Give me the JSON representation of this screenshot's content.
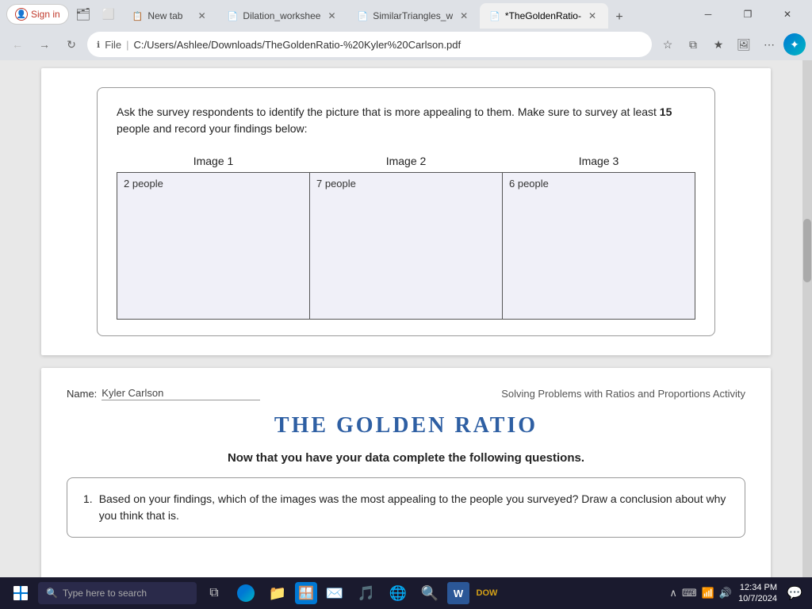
{
  "browser": {
    "tabs": [
      {
        "id": "sign-in",
        "type": "sign-in",
        "label": "Sign in"
      },
      {
        "id": "tab1",
        "icon": "📋",
        "label": "New tab",
        "closable": true,
        "active": false
      },
      {
        "id": "tab2",
        "icon": "📄",
        "label": "Dilation_workshee",
        "closable": true,
        "active": false
      },
      {
        "id": "tab3",
        "icon": "📄",
        "label": "SimilarTriangles_w",
        "closable": true,
        "active": false
      },
      {
        "id": "tab4",
        "icon": "📄",
        "label": "*TheGoldenRatio-",
        "closable": true,
        "active": true
      }
    ],
    "url": "C:/Users/Ashlee/Downloads/TheGoldenRatio-%20Kyler%20Carlson.pdf",
    "url_icon": "ℹ️",
    "file_label": "File"
  },
  "page1": {
    "instruction": "Ask the survey respondents to identify the picture that is more appealing to them. Make sure to survey at least 15 people and record your findings below:",
    "instruction_bold": "15",
    "images": [
      {
        "header": "Image 1",
        "content": "2 people"
      },
      {
        "header": "Image 2",
        "content": "7 people"
      },
      {
        "header": "Image 3",
        "content": "6 people"
      }
    ]
  },
  "page2": {
    "name_label": "Name:",
    "name_value": "Kyler Carlson",
    "activity_title": "Solving Problems with Ratios and Proportions Activity",
    "main_title": "THE GOLDEN RATIO",
    "subtitle": "Now that you have your data complete the following questions.",
    "question_number": "1.",
    "question_text": "Based on your findings, which of the images was the most appealing to the people you surveyed? Draw a conclusion about why you think that is."
  },
  "taskbar": {
    "search_placeholder": "Type here to search",
    "clock_time": "12:34 PM",
    "clock_date": "10/7/2024",
    "apps": [
      "🗂️",
      "🌐",
      "📁",
      "🪟",
      "📧",
      "🎵",
      "🌐",
      "🔍",
      "W"
    ]
  }
}
